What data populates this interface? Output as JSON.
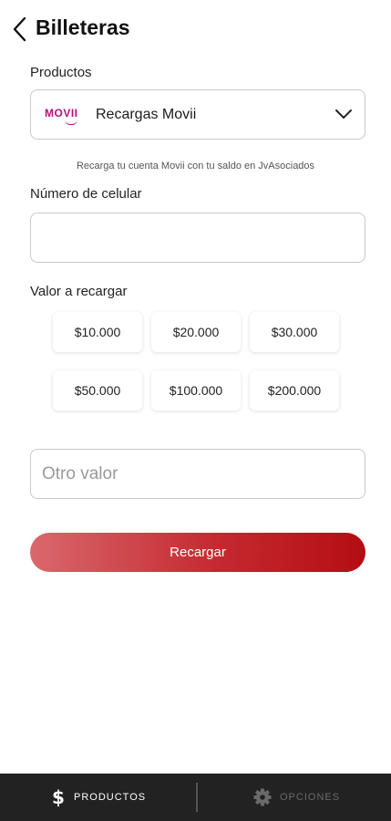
{
  "header": {
    "title": "Billeteras",
    "back_icon": "chevron-left-icon"
  },
  "products": {
    "label": "Productos",
    "brand_logo_text": "MOVII",
    "selected": "Recargas Movii",
    "dropdown_icon": "chevron-down-icon",
    "hint": "Recarga tu cuenta Movii con tu saldo en JvAsociados"
  },
  "phone": {
    "label": "Número de celular",
    "value": "",
    "placeholder": ""
  },
  "amounts": {
    "label": "Valor a recargar",
    "options": [
      "$10.000",
      "$20.000",
      "$30.000",
      "$50.000",
      "$100.000",
      "$200.000"
    ]
  },
  "other": {
    "value": "",
    "placeholder": "Otro valor"
  },
  "submit_label": "Recargar",
  "colors": {
    "accent": "#c01a20",
    "brand": "#b3127d",
    "nav_bg": "#222222"
  },
  "bottom_nav": [
    {
      "label": "PRODUCTOS",
      "icon": "dollar-icon",
      "active": true
    },
    {
      "label": "OPCIONES",
      "icon": "gear-icon",
      "active": false
    }
  ]
}
